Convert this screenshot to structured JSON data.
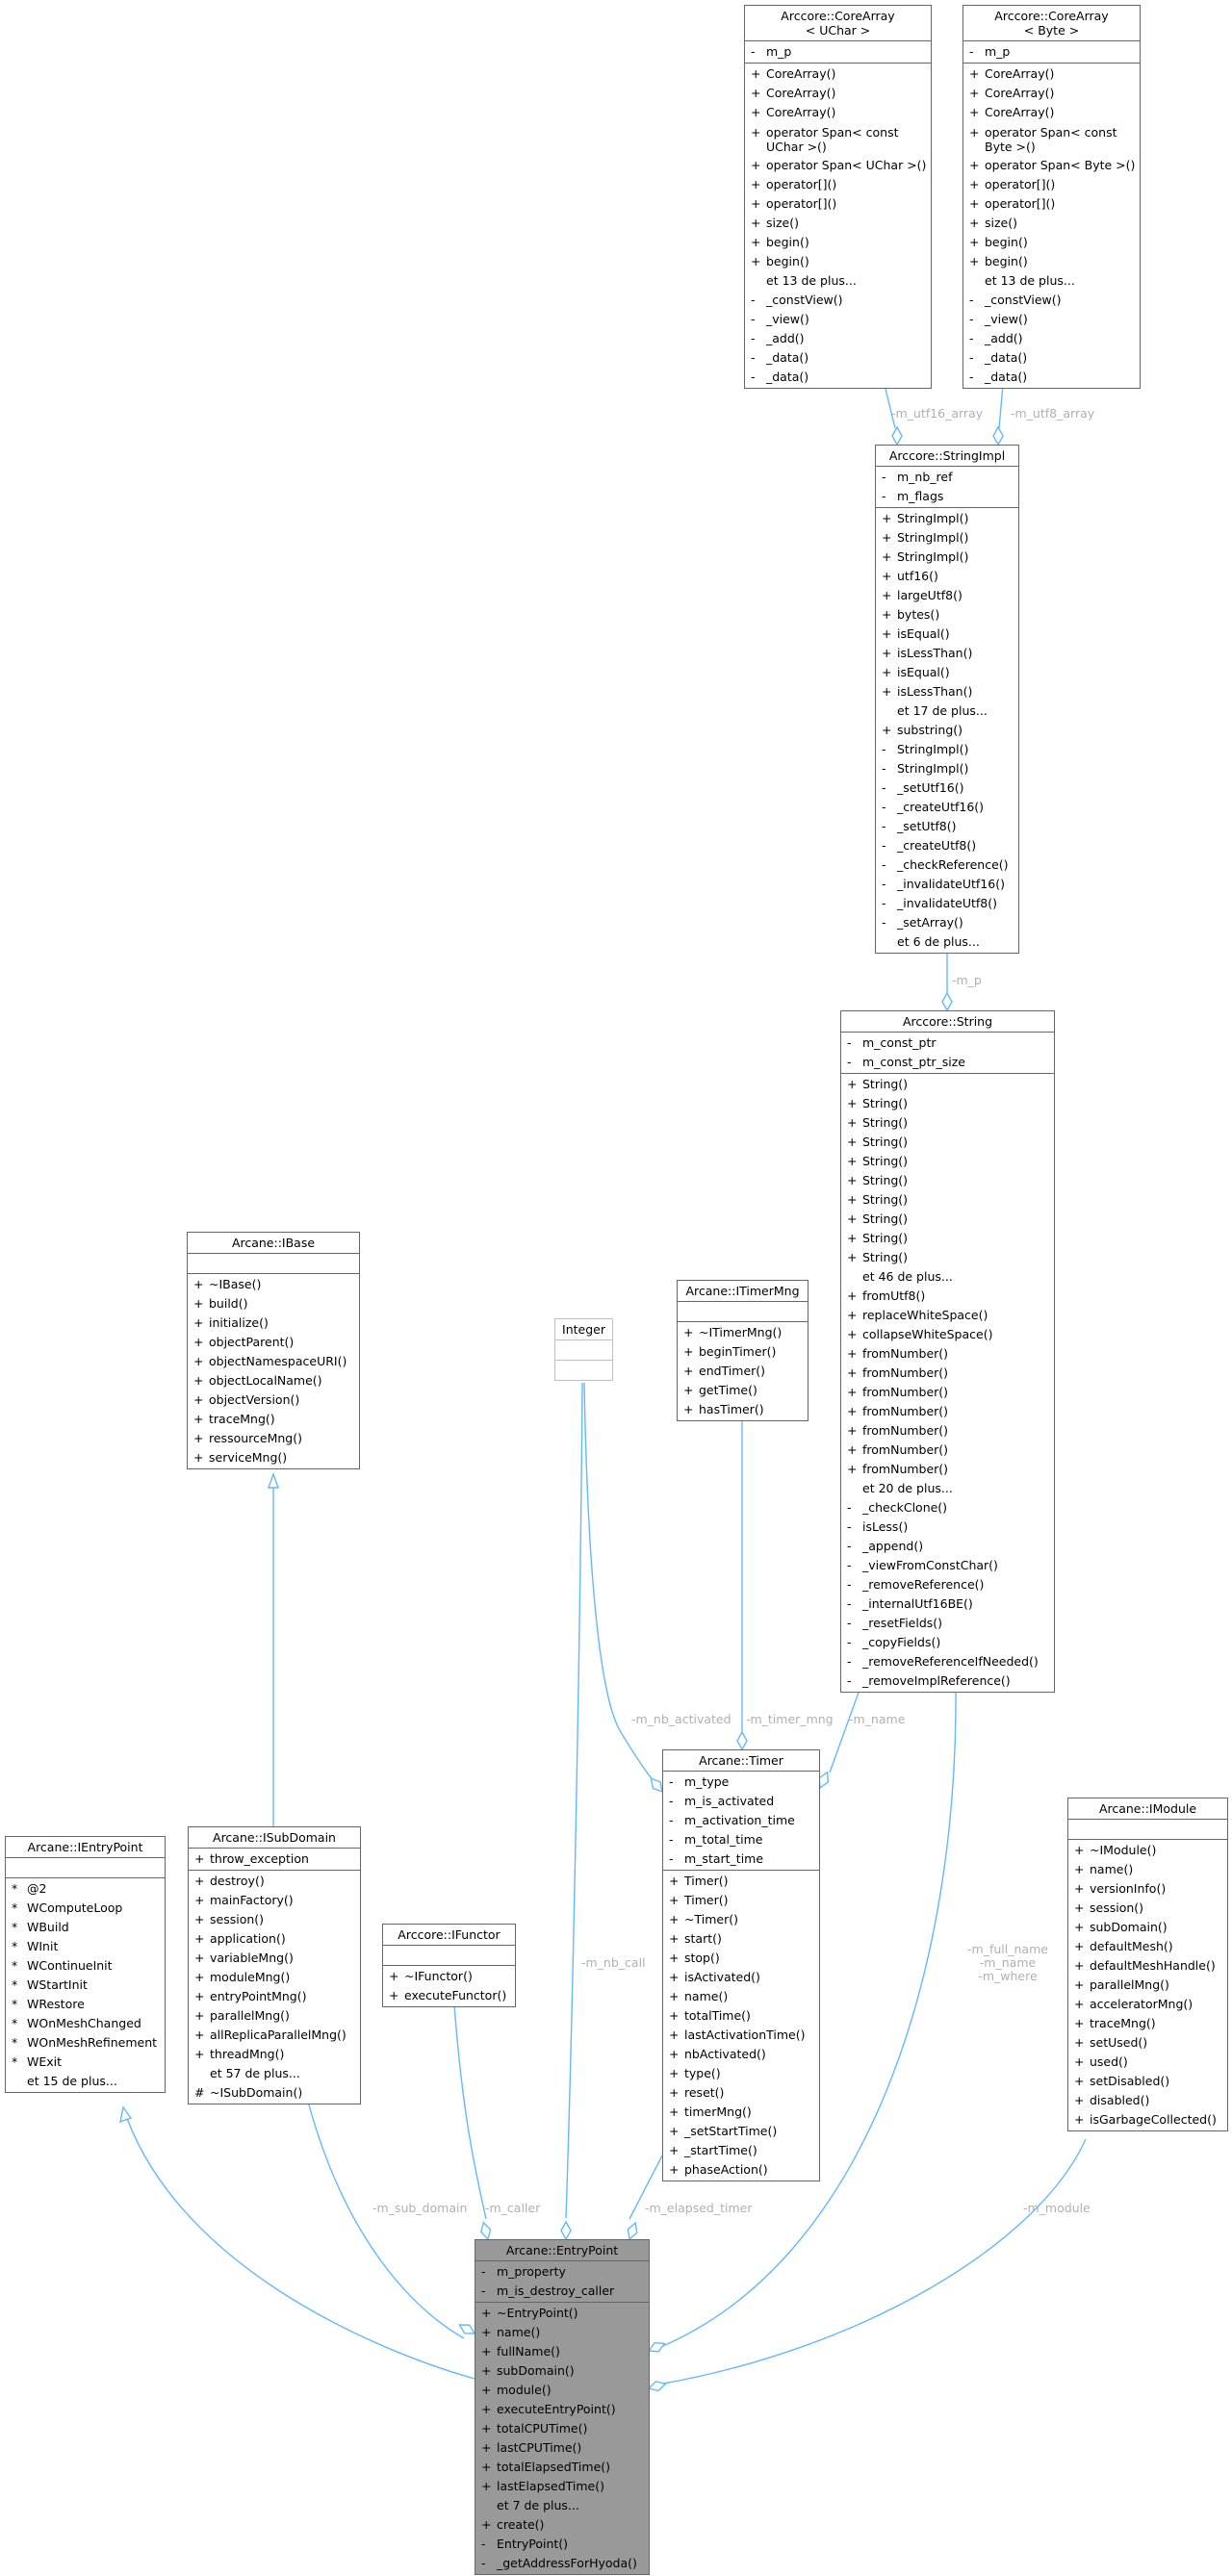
{
  "diagram": {
    "type": "collaboration-graph",
    "focus_class": "Arcane::EntryPoint"
  },
  "colors": {
    "edge": "#63b8ff",
    "edge_label": "#b0b0b0",
    "focus_fill": "#999999",
    "border": "#666666",
    "faded_border": "#bfbfbf"
  },
  "classes": {
    "corearray_uchar": {
      "title": "Arccore::CoreArray\n< UChar >",
      "attributes": [
        {
          "v": "-",
          "n": "m_p"
        }
      ],
      "methods": [
        {
          "v": "+",
          "n": "CoreArray()"
        },
        {
          "v": "+",
          "n": "CoreArray()"
        },
        {
          "v": "+",
          "n": "CoreArray()"
        },
        {
          "v": "+",
          "n": "operator Span< const\n UChar >()"
        },
        {
          "v": "+",
          "n": "operator Span< UChar >()"
        },
        {
          "v": "+",
          "n": "operator[]()"
        },
        {
          "v": "+",
          "n": "operator[]()"
        },
        {
          "v": "+",
          "n": "size()"
        },
        {
          "v": "+",
          "n": "begin()"
        },
        {
          "v": "+",
          "n": "begin()"
        },
        {
          "v": "",
          "n": "et 13 de plus..."
        },
        {
          "v": "-",
          "n": "_constView()"
        },
        {
          "v": "-",
          "n": "_view()"
        },
        {
          "v": "-",
          "n": "_add()"
        },
        {
          "v": "-",
          "n": "_data()"
        },
        {
          "v": "-",
          "n": "_data()"
        }
      ]
    },
    "corearray_byte": {
      "title": "Arccore::CoreArray\n< Byte >",
      "attributes": [
        {
          "v": "-",
          "n": "m_p"
        }
      ],
      "methods": [
        {
          "v": "+",
          "n": "CoreArray()"
        },
        {
          "v": "+",
          "n": "CoreArray()"
        },
        {
          "v": "+",
          "n": "CoreArray()"
        },
        {
          "v": "+",
          "n": "operator Span< const\n Byte >()"
        },
        {
          "v": "+",
          "n": "operator Span< Byte >()"
        },
        {
          "v": "+",
          "n": "operator[]()"
        },
        {
          "v": "+",
          "n": "operator[]()"
        },
        {
          "v": "+",
          "n": "size()"
        },
        {
          "v": "+",
          "n": "begin()"
        },
        {
          "v": "+",
          "n": "begin()"
        },
        {
          "v": "",
          "n": "et 13 de plus..."
        },
        {
          "v": "-",
          "n": "_constView()"
        },
        {
          "v": "-",
          "n": "_view()"
        },
        {
          "v": "-",
          "n": "_add()"
        },
        {
          "v": "-",
          "n": "_data()"
        },
        {
          "v": "-",
          "n": "_data()"
        }
      ]
    },
    "stringimpl": {
      "title": "Arccore::StringImpl",
      "attributes": [
        {
          "v": "-",
          "n": "m_nb_ref"
        },
        {
          "v": "-",
          "n": "m_flags"
        }
      ],
      "methods": [
        {
          "v": "+",
          "n": "StringImpl()"
        },
        {
          "v": "+",
          "n": "StringImpl()"
        },
        {
          "v": "+",
          "n": "StringImpl()"
        },
        {
          "v": "+",
          "n": "utf16()"
        },
        {
          "v": "+",
          "n": "largeUtf8()"
        },
        {
          "v": "+",
          "n": "bytes()"
        },
        {
          "v": "+",
          "n": "isEqual()"
        },
        {
          "v": "+",
          "n": "isLessThan()"
        },
        {
          "v": "+",
          "n": "isEqual()"
        },
        {
          "v": "+",
          "n": "isLessThan()"
        },
        {
          "v": "",
          "n": "et 17 de plus..."
        },
        {
          "v": "+",
          "n": "substring()"
        },
        {
          "v": "-",
          "n": "StringImpl()"
        },
        {
          "v": "-",
          "n": "StringImpl()"
        },
        {
          "v": "-",
          "n": "_setUtf16()"
        },
        {
          "v": "-",
          "n": "_createUtf16()"
        },
        {
          "v": "-",
          "n": "_setUtf8()"
        },
        {
          "v": "-",
          "n": "_createUtf8()"
        },
        {
          "v": "-",
          "n": "_checkReference()"
        },
        {
          "v": "-",
          "n": "_invalidateUtf16()"
        },
        {
          "v": "-",
          "n": "_invalidateUtf8()"
        },
        {
          "v": "-",
          "n": "_setArray()"
        },
        {
          "v": "",
          "n": "et 6 de plus..."
        }
      ]
    },
    "string": {
      "title": "Arccore::String",
      "attributes": [
        {
          "v": "-",
          "n": "m_const_ptr"
        },
        {
          "v": "-",
          "n": "m_const_ptr_size"
        }
      ],
      "methods": [
        {
          "v": "+",
          "n": "String()"
        },
        {
          "v": "+",
          "n": "String()"
        },
        {
          "v": "+",
          "n": "String()"
        },
        {
          "v": "+",
          "n": "String()"
        },
        {
          "v": "+",
          "n": "String()"
        },
        {
          "v": "+",
          "n": "String()"
        },
        {
          "v": "+",
          "n": "String()"
        },
        {
          "v": "+",
          "n": "String()"
        },
        {
          "v": "+",
          "n": "String()"
        },
        {
          "v": "+",
          "n": "String()"
        },
        {
          "v": "",
          "n": "et 46 de plus..."
        },
        {
          "v": "+",
          "n": "fromUtf8()"
        },
        {
          "v": "+",
          "n": "replaceWhiteSpace()"
        },
        {
          "v": "+",
          "n": "collapseWhiteSpace()"
        },
        {
          "v": "+",
          "n": "fromNumber()"
        },
        {
          "v": "+",
          "n": "fromNumber()"
        },
        {
          "v": "+",
          "n": "fromNumber()"
        },
        {
          "v": "+",
          "n": "fromNumber()"
        },
        {
          "v": "+",
          "n": "fromNumber()"
        },
        {
          "v": "+",
          "n": "fromNumber()"
        },
        {
          "v": "+",
          "n": "fromNumber()"
        },
        {
          "v": "",
          "n": "et 20 de plus..."
        },
        {
          "v": "-",
          "n": "_checkClone()"
        },
        {
          "v": "-",
          "n": "isLess()"
        },
        {
          "v": "-",
          "n": "_append()"
        },
        {
          "v": "-",
          "n": "_viewFromConstChar()"
        },
        {
          "v": "-",
          "n": "_removeReference()"
        },
        {
          "v": "-",
          "n": "_internalUtf16BE()"
        },
        {
          "v": "-",
          "n": "_resetFields()"
        },
        {
          "v": "-",
          "n": "_copyFields()"
        },
        {
          "v": "-",
          "n": "_removeReferenceIfNeeded()"
        },
        {
          "v": "-",
          "n": "_removeImplReference()"
        }
      ]
    },
    "ibase": {
      "title": "Arcane::IBase",
      "attributes": [],
      "methods": [
        {
          "v": "+",
          "n": "~IBase()"
        },
        {
          "v": "+",
          "n": "build()"
        },
        {
          "v": "+",
          "n": "initialize()"
        },
        {
          "v": "+",
          "n": "objectParent()"
        },
        {
          "v": "+",
          "n": "objectNamespaceURI()"
        },
        {
          "v": "+",
          "n": "objectLocalName()"
        },
        {
          "v": "+",
          "n": "objectVersion()"
        },
        {
          "v": "+",
          "n": "traceMng()"
        },
        {
          "v": "+",
          "n": "ressourceMng()"
        },
        {
          "v": "+",
          "n": "serviceMng()"
        }
      ]
    },
    "integer": {
      "title": "Integer",
      "attributes": [],
      "methods": []
    },
    "itimermng": {
      "title": "Arcane::ITimerMng",
      "attributes": [],
      "methods": [
        {
          "v": "+",
          "n": "~ITimerMng()"
        },
        {
          "v": "+",
          "n": "beginTimer()"
        },
        {
          "v": "+",
          "n": "endTimer()"
        },
        {
          "v": "+",
          "n": "getTime()"
        },
        {
          "v": "+",
          "n": "hasTimer()"
        }
      ]
    },
    "timer": {
      "title": "Arcane::Timer",
      "attributes": [
        {
          "v": "-",
          "n": "m_type"
        },
        {
          "v": "-",
          "n": "m_is_activated"
        },
        {
          "v": "-",
          "n": "m_activation_time"
        },
        {
          "v": "-",
          "n": "m_total_time"
        },
        {
          "v": "-",
          "n": "m_start_time"
        }
      ],
      "methods": [
        {
          "v": "+",
          "n": "Timer()"
        },
        {
          "v": "+",
          "n": "Timer()"
        },
        {
          "v": "+",
          "n": "~Timer()"
        },
        {
          "v": "+",
          "n": "start()"
        },
        {
          "v": "+",
          "n": "stop()"
        },
        {
          "v": "+",
          "n": "isActivated()"
        },
        {
          "v": "+",
          "n": "name()"
        },
        {
          "v": "+",
          "n": "totalTime()"
        },
        {
          "v": "+",
          "n": "lastActivationTime()"
        },
        {
          "v": "+",
          "n": "nbActivated()"
        },
        {
          "v": "+",
          "n": "type()"
        },
        {
          "v": "+",
          "n": "reset()"
        },
        {
          "v": "+",
          "n": "timerMng()"
        },
        {
          "v": "+",
          "n": "_setStartTime()"
        },
        {
          "v": "+",
          "n": "_startTime()"
        },
        {
          "v": "+",
          "n": "phaseAction()"
        }
      ]
    },
    "ientrypoint": {
      "title": "Arcane::IEntryPoint",
      "attributes": [],
      "methods": [
        {
          "v": "*",
          "n": "@2"
        },
        {
          "v": "*",
          "n": "WComputeLoop"
        },
        {
          "v": "*",
          "n": "WBuild"
        },
        {
          "v": "*",
          "n": "WInit"
        },
        {
          "v": "*",
          "n": "WContinueInit"
        },
        {
          "v": "*",
          "n": "WStartInit"
        },
        {
          "v": "*",
          "n": "WRestore"
        },
        {
          "v": "*",
          "n": "WOnMeshChanged"
        },
        {
          "v": "*",
          "n": "WOnMeshRefinement"
        },
        {
          "v": "*",
          "n": "WExit"
        },
        {
          "v": "",
          "n": "et 15 de plus..."
        }
      ]
    },
    "isubdomain": {
      "title": "Arcane::ISubDomain",
      "attributes": [
        {
          "v": "+",
          "n": "throw_exception"
        }
      ],
      "methods": [
        {
          "v": "+",
          "n": "destroy()"
        },
        {
          "v": "+",
          "n": "mainFactory()"
        },
        {
          "v": "+",
          "n": "session()"
        },
        {
          "v": "+",
          "n": "application()"
        },
        {
          "v": "+",
          "n": "variableMng()"
        },
        {
          "v": "+",
          "n": "moduleMng()"
        },
        {
          "v": "+",
          "n": "entryPointMng()"
        },
        {
          "v": "+",
          "n": "parallelMng()"
        },
        {
          "v": "+",
          "n": "allReplicaParallelMng()"
        },
        {
          "v": "+",
          "n": "threadMng()"
        },
        {
          "v": "",
          "n": "et 57 de plus..."
        },
        {
          "v": "#",
          "n": "~ISubDomain()"
        }
      ]
    },
    "ifunctor": {
      "title": "Arccore::IFunctor",
      "attributes": [],
      "methods": [
        {
          "v": "+",
          "n": "~IFunctor()"
        },
        {
          "v": "+",
          "n": "executeFunctor()"
        }
      ]
    },
    "imodule": {
      "title": "Arcane::IModule",
      "attributes": [],
      "methods": [
        {
          "v": "+",
          "n": "~IModule()"
        },
        {
          "v": "+",
          "n": "name()"
        },
        {
          "v": "+",
          "n": "versionInfo()"
        },
        {
          "v": "+",
          "n": "session()"
        },
        {
          "v": "+",
          "n": "subDomain()"
        },
        {
          "v": "+",
          "n": "defaultMesh()"
        },
        {
          "v": "+",
          "n": "defaultMeshHandle()"
        },
        {
          "v": "+",
          "n": "parallelMng()"
        },
        {
          "v": "+",
          "n": "acceleratorMng()"
        },
        {
          "v": "+",
          "n": "traceMng()"
        },
        {
          "v": "+",
          "n": "setUsed()"
        },
        {
          "v": "+",
          "n": "used()"
        },
        {
          "v": "+",
          "n": "setDisabled()"
        },
        {
          "v": "+",
          "n": "disabled()"
        },
        {
          "v": "+",
          "n": "isGarbageCollected()"
        }
      ]
    },
    "entrypoint": {
      "title": "Arcane::EntryPoint",
      "attributes": [
        {
          "v": "-",
          "n": "m_property"
        },
        {
          "v": "-",
          "n": "m_is_destroy_caller"
        }
      ],
      "methods": [
        {
          "v": "+",
          "n": "~EntryPoint()"
        },
        {
          "v": "+",
          "n": "name()"
        },
        {
          "v": "+",
          "n": "fullName()"
        },
        {
          "v": "+",
          "n": "subDomain()"
        },
        {
          "v": "+",
          "n": "module()"
        },
        {
          "v": "+",
          "n": "executeEntryPoint()"
        },
        {
          "v": "+",
          "n": "totalCPUTime()"
        },
        {
          "v": "+",
          "n": "lastCPUTime()"
        },
        {
          "v": "+",
          "n": "totalElapsedTime()"
        },
        {
          "v": "+",
          "n": "lastElapsedTime()"
        },
        {
          "v": "",
          "n": "et 7 de plus..."
        },
        {
          "v": "+",
          "n": "create()"
        },
        {
          "v": "-",
          "n": "EntryPoint()"
        },
        {
          "v": "-",
          "n": "_getAddressForHyoda()"
        }
      ]
    }
  },
  "edge_labels": {
    "utf16_array": "-m_utf16_array",
    "utf8_array": "-m_utf8_array",
    "m_p": "-m_p",
    "nb_activated": "-m_nb_activated",
    "timer_mng": "-m_timer_mng",
    "timer_name": "-m_name",
    "nb_call": "-m_nb_call",
    "full_name": "-m_full_name",
    "name": "-m_name",
    "where": "-m_where",
    "sub_domain": "-m_sub_domain",
    "caller": "-m_caller",
    "elapsed_timer": "-m_elapsed_timer",
    "module": "-m_module"
  }
}
